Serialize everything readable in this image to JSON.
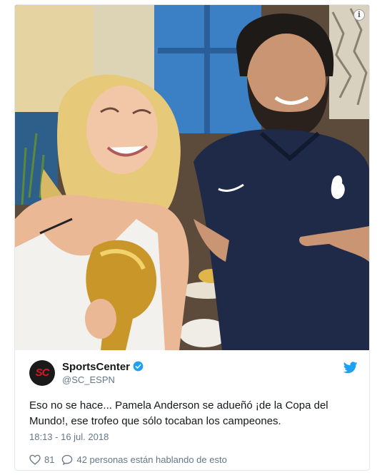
{
  "tweet": {
    "author_name": "SportsCenter",
    "author_handle": "@SC_ESPN",
    "avatar_text": "SC",
    "verified": true,
    "text": "Eso no se hace... Pamela Anderson se adueñó ¡de la Copa del Mundo!, ese trofeo que sólo tocaban los campeones.",
    "timestamp": "18:13 - 16 jul. 2018",
    "likes_count": "81",
    "conversation_text": "42 personas están hablando de esto",
    "info_icon_label": "i"
  },
  "icons": {
    "info": "info-icon",
    "verified": "verified-badge-icon",
    "twitter": "twitter-bird-icon",
    "like": "heart-icon",
    "reply": "speech-bubble-icon"
  },
  "colors": {
    "twitter_blue": "#1da1f2",
    "text_primary": "#14171a",
    "text_secondary": "#657786",
    "border": "#e1e8ed",
    "avatar_bg": "#1a1a1a",
    "avatar_accent": "#d41b24"
  }
}
